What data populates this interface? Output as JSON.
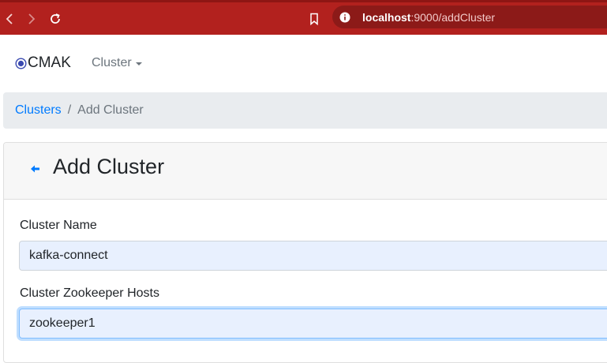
{
  "browser": {
    "url_host": "localhost",
    "url_path": ":9000/addCluster"
  },
  "navbar": {
    "brand": "CMAK",
    "cluster_menu": "Cluster"
  },
  "breadcrumb": {
    "link": "Clusters",
    "separator": "/",
    "active": "Add Cluster"
  },
  "card": {
    "title": "Add Cluster",
    "fields": [
      {
        "label": "Cluster Name",
        "value": "kafka-connect"
      },
      {
        "label": "Cluster Zookeeper Hosts",
        "value": "zookeeper1"
      }
    ]
  },
  "colors": {
    "chrome": "#b2211e",
    "link": "#007bff",
    "input_autofill": "#e8f0fe"
  },
  "icons": {
    "back": "chevron-left-icon",
    "forward": "chevron-right-icon",
    "reload": "reload-icon",
    "bookmark": "bookmark-icon",
    "info": "info-icon",
    "brand": "target-icon",
    "card_back": "arrow-left-icon"
  }
}
